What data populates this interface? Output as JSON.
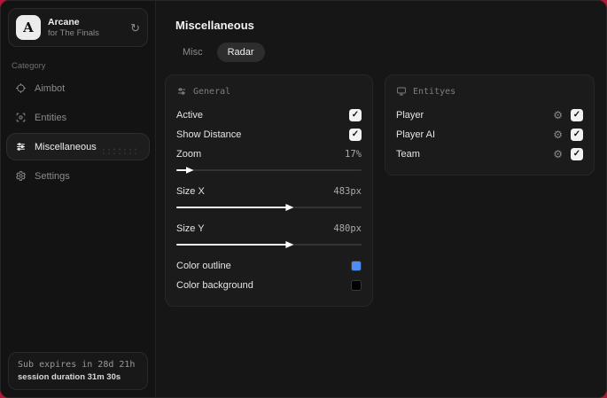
{
  "sidebar": {
    "brand": {
      "initial": "A",
      "title": "Arcane",
      "subtitle": "for The Finals"
    },
    "category_label": "Category",
    "items": [
      {
        "label": "Aimbot"
      },
      {
        "label": "Entities"
      },
      {
        "label": "Miscellaneous"
      },
      {
        "label": "Settings"
      }
    ],
    "status": {
      "line1": "Sub expires in 28d 21h",
      "line2": "session duration 31m 30s"
    }
  },
  "main": {
    "title": "Miscellaneous",
    "tabs": [
      {
        "label": "Misc"
      },
      {
        "label": "Radar"
      }
    ],
    "general_panel": {
      "title": "General",
      "toggles": [
        {
          "label": "Active",
          "checked": true
        },
        {
          "label": "Show Distance",
          "checked": true
        }
      ],
      "sliders": [
        {
          "label": "Zoom",
          "value": "17%",
          "percent": 6
        },
        {
          "label": "Size X",
          "value": "483px",
          "percent": 60
        },
        {
          "label": "Size Y",
          "value": "480px",
          "percent": 60
        }
      ],
      "colors": [
        {
          "label": "Color outline",
          "swatch": "#4e8df5"
        },
        {
          "label": "Color background",
          "swatch": "#000000"
        }
      ]
    },
    "entities_panel": {
      "title": "Entityes",
      "rows": [
        {
          "label": "Player",
          "checked": true
        },
        {
          "label": "Player AI",
          "checked": true
        },
        {
          "label": "Team",
          "checked": true
        }
      ]
    }
  }
}
